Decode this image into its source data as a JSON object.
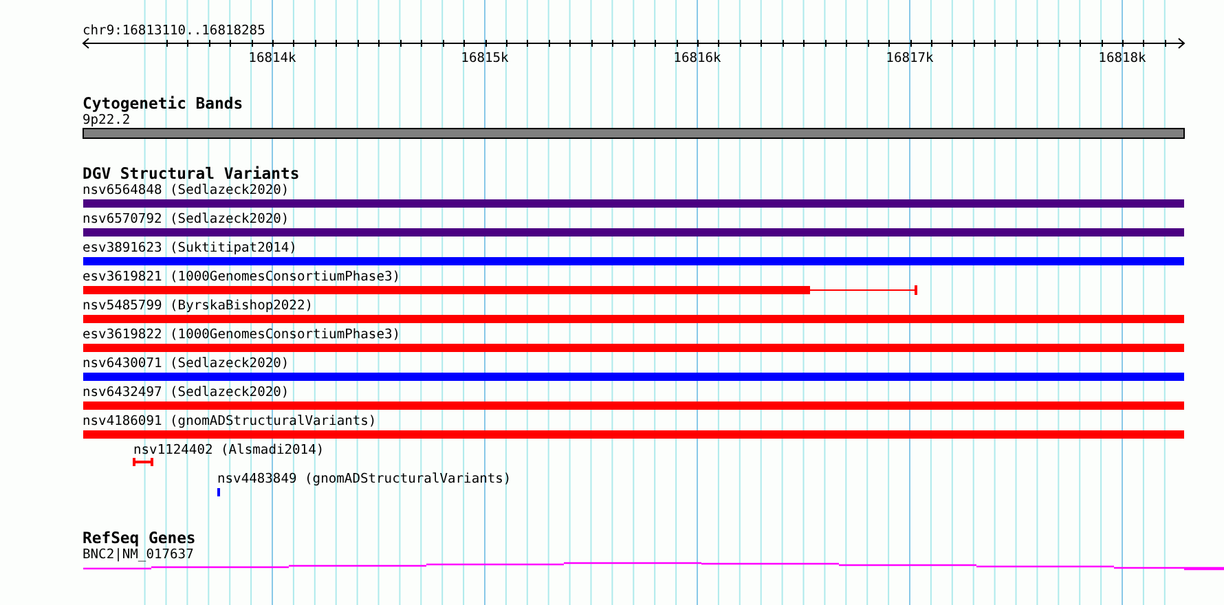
{
  "ruler": {
    "region": "chr9:16813110..16818285",
    "ticks": [
      "16814k",
      "16815k",
      "16816k",
      "16817k",
      "16818k"
    ]
  },
  "tracks": [
    {
      "title": "Cytogenetic Bands",
      "kind": "band",
      "features": [
        {
          "label": "9p22.2"
        }
      ]
    },
    {
      "title": "DGV Structural Variants",
      "kind": "variants",
      "features": [
        {
          "label": "nsv6564848 (Sedlazeck2020)",
          "color": "#4b0082"
        },
        {
          "label": "nsv6570792 (Sedlazeck2020)",
          "color": "#4b0082"
        },
        {
          "label": "esv3891623 (Suktitipat2014)",
          "color": "#0000ff"
        },
        {
          "label": "esv3619821 (1000GenomesConsortiumPhase3)",
          "color": "#ff0000"
        },
        {
          "label": "nsv5485799 (ByrskaBishop2022)",
          "color": "#ff0000"
        },
        {
          "label": "esv3619822 (1000GenomesConsortiumPhase3)",
          "color": "#ff0000"
        },
        {
          "label": "nsv6430071 (Sedlazeck2020)",
          "color": "#0000ff"
        },
        {
          "label": "nsv6432497 (Sedlazeck2020)",
          "color": "#ff0000"
        },
        {
          "label": "nsv4186091 (gnomADStructuralVariants)",
          "color": "#ff0000"
        },
        {
          "label": "nsv1124402 (Alsmadi2014)",
          "color": "#ff0000"
        },
        {
          "label": "nsv4483849 (gnomADStructuralVariants)",
          "color": "#0000ff"
        }
      ]
    },
    {
      "title": "RefSeq Genes",
      "kind": "gene",
      "features": [
        {
          "label": "BNC2|NM_017637"
        }
      ]
    }
  ]
}
